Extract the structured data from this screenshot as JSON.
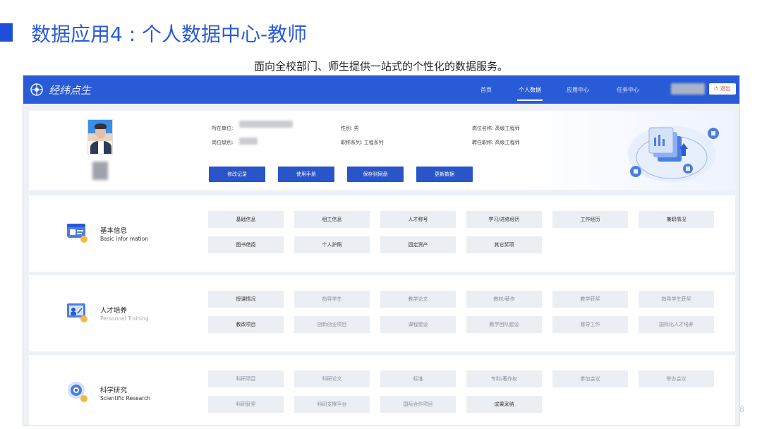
{
  "slide": {
    "title": "数据应用4 : 个人数据中心-教师",
    "subtitle": "面向全校部门、师生提供一站式的个性化的数据服务。",
    "page_number": "8"
  },
  "navbar": {
    "logo_text": "经纬点生",
    "items": [
      {
        "label": "首页",
        "active": false
      },
      {
        "label": "个人数据",
        "active": true
      },
      {
        "label": "应用中心",
        "active": false
      },
      {
        "label": "任务中心",
        "active": false
      }
    ],
    "logout_label": "⏻ 退出"
  },
  "profile": {
    "unit_label": "所在单位:",
    "level_label": "岗位级别:",
    "gender_label": "性别:",
    "gender_value": "男",
    "title_series_label": "职称系列:",
    "title_series_value": "工程系列",
    "post_name_label": "岗位名称:",
    "post_name_value": "高级工程师",
    "hired_title_label": "聘任职称:",
    "hired_title_value": "高级工程师",
    "actions": [
      "修改记录",
      "使用手册",
      "保存到网盘",
      "更新数据"
    ]
  },
  "sections": [
    {
      "title": "基本信息",
      "subtitle": "Basic infor mation",
      "icon": "id-card-icon",
      "tags": [
        "基础信息",
        "组工信息",
        "人才称号",
        "学习/进修经历",
        "工作经历",
        "兼职情况",
        "图书借阅",
        "个人护照",
        "固定资产",
        "其它奖项"
      ]
    },
    {
      "title": "人才培养",
      "subtitle": "Personnel Training",
      "icon": "teacher-board-icon",
      "tags": [
        "授课情况",
        "指导学生",
        "教学论文",
        "教材/著作",
        "教学获奖",
        "指导学生获奖",
        "教改项目",
        "创新创业项目",
        "课程建设",
        "教学团队建设",
        "督导工作",
        "国际化人才培养"
      ]
    },
    {
      "title": "科学研究",
      "subtitle": "Scientific Research",
      "icon": "target-icon",
      "tags": [
        "科研项目",
        "科研论文",
        "标准",
        "专利/著作权",
        "参加会议",
        "举办会议",
        "科研获奖",
        "科研支撑平台",
        "国际合作项目",
        "成果采纳"
      ]
    }
  ],
  "colors": {
    "brand": "#2a5bd7",
    "button": "#2a55c8",
    "tag_bg": "#ebeef3"
  }
}
